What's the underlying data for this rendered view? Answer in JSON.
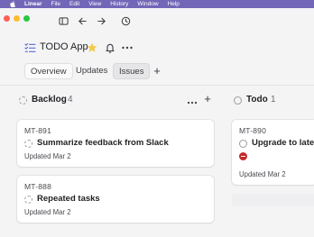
{
  "menubar": {
    "app_name": "Linear",
    "items": [
      "File",
      "Edit",
      "View",
      "History",
      "Window",
      "Help"
    ]
  },
  "window": {
    "icons": [
      "sidebar-toggle-icon",
      "back-arrow-icon",
      "forward-arrow-icon",
      "history-clock-icon"
    ]
  },
  "project": {
    "title": "TODO App",
    "favorite": true,
    "colors": {
      "accent": "#5e6ad2",
      "star": "#f2c94c",
      "menubar": "#7266b8"
    }
  },
  "tabs": [
    {
      "label": "Overview",
      "active": false
    },
    {
      "label": "Updates",
      "active": false
    },
    {
      "label": "Issues",
      "active": true
    }
  ],
  "columns": [
    {
      "name": "Backlog",
      "count": "4",
      "cards": [
        {
          "id": "MT-891",
          "title": "Summarize feedback from Slack",
          "updated": "Updated Mar 2"
        },
        {
          "id": "MT-888",
          "title": "Repeated tasks",
          "updated": "Updated Mar 2"
        }
      ]
    },
    {
      "name": "Todo",
      "count": "1",
      "cards": [
        {
          "id": "MT-890",
          "title": "Upgrade to latest",
          "updated": "Updated Mar 2",
          "priority": "urgent",
          "priority_color": "#c52828"
        }
      ]
    }
  ]
}
